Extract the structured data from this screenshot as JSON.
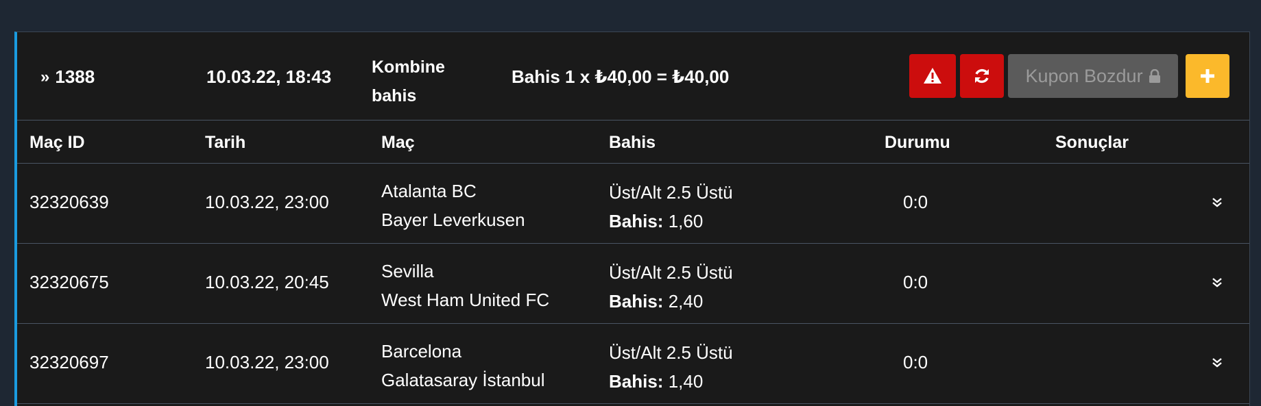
{
  "coupon": {
    "id": "1388",
    "date": "10.03.22, 18:43",
    "type_line1": "Kombine",
    "type_line2": "bahis",
    "stake": "Bahis 1 x ₺40,00 = ₺40,00",
    "buttons": {
      "warning_icon": "warning-icon",
      "refresh_icon": "refresh-icon",
      "cashout_label": "Kupon Bozdur",
      "cashout_icon": "lock-icon",
      "add_icon": "plus-icon"
    },
    "colors": {
      "accent": "#1a9be0",
      "danger": "#cc0d0d",
      "disabled": "#5b5b5b",
      "warning": "#fbb92b"
    }
  },
  "table": {
    "headers": {
      "match_id": "Maç ID",
      "date": "Tarih",
      "match": "Maç",
      "bet": "Bahis",
      "status": "Durumu",
      "results": "Sonuçlar"
    },
    "rows": [
      {
        "match_id": "32320639",
        "date": "10.03.22, 23:00",
        "home": "Atalanta BC",
        "away": "Bayer Leverkusen",
        "market": "Üst/Alt 2.5 Üstü",
        "odds_label": "Bahis:",
        "odds": "1,60",
        "status": "0:0"
      },
      {
        "match_id": "32320675",
        "date": "10.03.22, 20:45",
        "home": "Sevilla",
        "away": "West Ham United FC",
        "market": "Üst/Alt 2.5 Üstü",
        "odds_label": "Bahis:",
        "odds": "2,40",
        "status": "0:0"
      },
      {
        "match_id": "32320697",
        "date": "10.03.22, 23:00",
        "home": "Barcelona",
        "away": "Galatasaray İstanbul",
        "market": "Üst/Alt 2.5 Üstü",
        "odds_label": "Bahis:",
        "odds": "1,40",
        "status": "0:0"
      }
    ]
  }
}
